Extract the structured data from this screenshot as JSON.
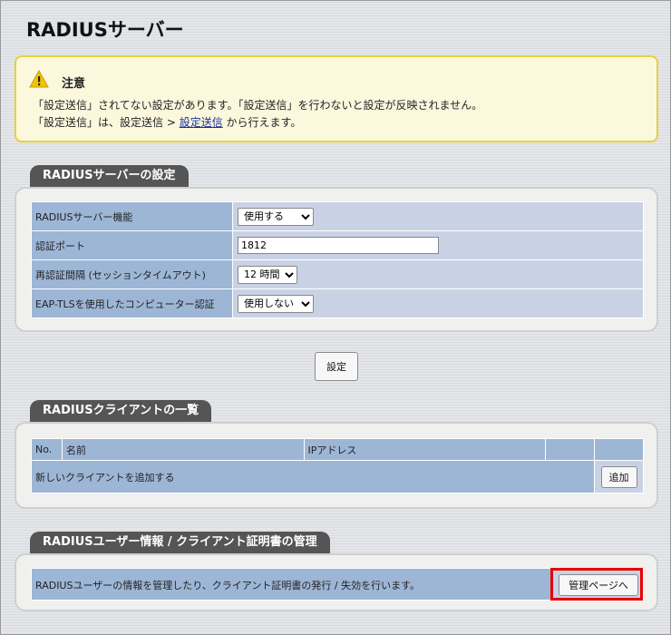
{
  "page": {
    "title": "RADIUSサーバー"
  },
  "notice": {
    "title": "注意",
    "line1": "「設定送信」されてない設定があります。「設定送信」を行わないと設定が反映されません。",
    "line2_prefix": "「設定送信」は、設定送信 > ",
    "line2_link": "設定送信",
    "line2_suffix": " から行えます。",
    "icon": "warning-icon"
  },
  "settings": {
    "heading": "RADIUSサーバーの設定",
    "rows": [
      {
        "label": "RADIUSサーバー機能",
        "value": "使用する"
      },
      {
        "label": "認証ポート",
        "value": "1812"
      },
      {
        "label": "再認証間隔 (セッションタイムアウト)",
        "value": "12 時間"
      },
      {
        "label": "EAP-TLSを使用したコンピューター認証",
        "value": "使用しない"
      }
    ],
    "submit_label": "設定"
  },
  "clients": {
    "heading": "RADIUSクライアントの一覧",
    "columns": [
      "No.",
      "名前",
      "IPアドレス",
      "",
      ""
    ],
    "add_row_text": "新しいクライアントを追加する",
    "add_button": "追加"
  },
  "management": {
    "heading": "RADIUSユーザー情報 / クライアント証明書の管理",
    "description": "RADIUSユーザーの情報を管理したり、クライアント証明書の発行 / 失効を行います。",
    "button": "管理ページへ"
  },
  "colors": {
    "highlight": "#e60000",
    "label_bg": "#9db6d6",
    "value_bg": "#c9d2e5",
    "tab_bg": "#555555"
  }
}
